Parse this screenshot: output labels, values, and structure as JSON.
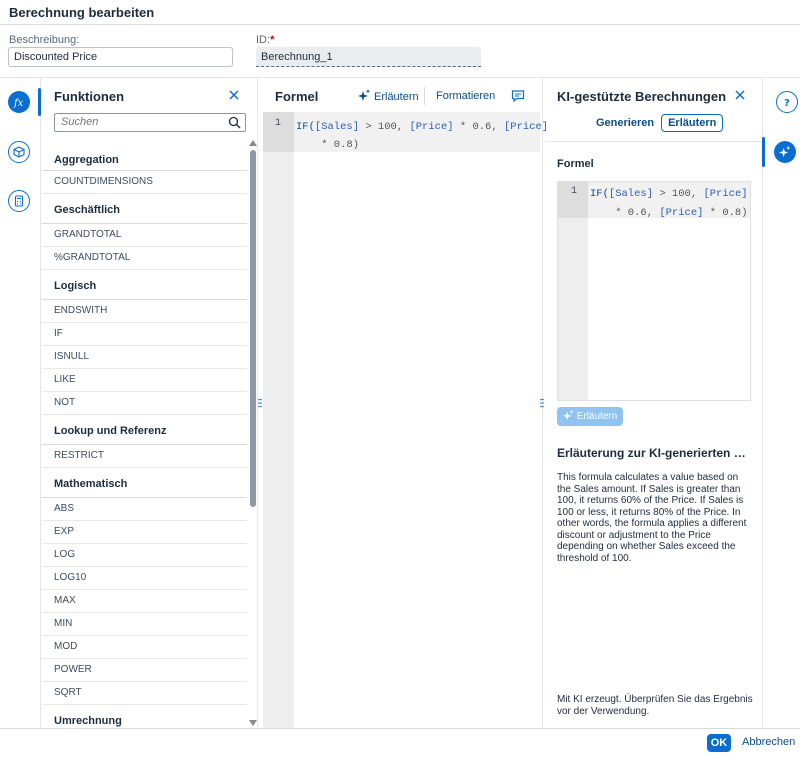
{
  "header": {
    "title": "Berechnung bearbeiten"
  },
  "form": {
    "description_label": "Beschreibung:",
    "description_value": "Discounted Price",
    "id_label": "ID:",
    "id_required_mark": "*",
    "id_value": "Berechnung_1"
  },
  "left_rail": {
    "items": [
      {
        "icon": "function-icon",
        "active": true
      },
      {
        "icon": "cube-icon",
        "active": false
      },
      {
        "icon": "calculator-icon",
        "active": false
      }
    ]
  },
  "functions_panel": {
    "title": "Funktionen",
    "search_placeholder": "Suchen",
    "groups": [
      {
        "name": "Aggregation",
        "items": [
          "COUNTDIMENSIONS"
        ]
      },
      {
        "name": "Geschäftlich",
        "items": [
          "GRANDTOTAL",
          "%GRANDTOTAL"
        ]
      },
      {
        "name": "Logisch",
        "items": [
          "ENDSWITH",
          "IF",
          "ISNULL",
          "LIKE",
          "NOT"
        ]
      },
      {
        "name": "Lookup und Referenz",
        "items": [
          "RESTRICT"
        ]
      },
      {
        "name": "Mathematisch",
        "items": [
          "ABS",
          "EXP",
          "LOG",
          "LOG10",
          "MAX",
          "MIN",
          "MOD",
          "POWER",
          "SQRT"
        ]
      },
      {
        "name": "Umrechnung",
        "items": []
      }
    ]
  },
  "formula_panel": {
    "title": "Formel",
    "explain_label": "Erläutern",
    "format_label": "Formatieren",
    "line_number": "1",
    "code": {
      "kw_if": "IF(",
      "ref_sales": "[Sales]",
      "op1": " > 100, ",
      "ref_price1": "[Price]",
      "op2": " * 0.6, ",
      "ref_price2": "[Price]",
      "line2": "    * 0.8)"
    }
  },
  "ai_panel": {
    "title": "KI-gestützte Berechnungen",
    "tab_generate": "Generieren",
    "tab_explain": "Erläutern",
    "formula_label": "Formel",
    "line_number": "1",
    "code": {
      "kw_if": "IF(",
      "ref_sales": "[Sales]",
      "op1": " > 100, ",
      "ref_price1": "[Price]",
      "line2_pre": "    * 0.6, ",
      "ref_price2": "[Price]",
      "line2_post": " * 0.8)"
    },
    "explain_button": "Erläutern",
    "explanation_title": "Erläuterung zur KI-generierten Formel",
    "explanation_text": "This formula calculates a value based on the Sales amount. If Sales is greater than 100, it returns 60% of the Price. If Sales is 100 or less, it returns 80% of the Price. In other words, the formula applies a different discount or adjustment to the Price depending on whether Sales exceed the threshold of 100.",
    "note": "Mit KI erzeugt. Überprüfen Sie das Ergebnis vor der Verwendung."
  },
  "right_rail": {
    "items": [
      {
        "icon": "help-icon",
        "active": false
      },
      {
        "icon": "ai-sparkle-icon",
        "active": true
      }
    ]
  },
  "footer": {
    "ok_label": "OK",
    "cancel_label": "Abbrechen"
  },
  "colors": {
    "accent": "#0a6ed1",
    "link": "#0a4d8c",
    "disabled_button": "#8ec4ef"
  }
}
